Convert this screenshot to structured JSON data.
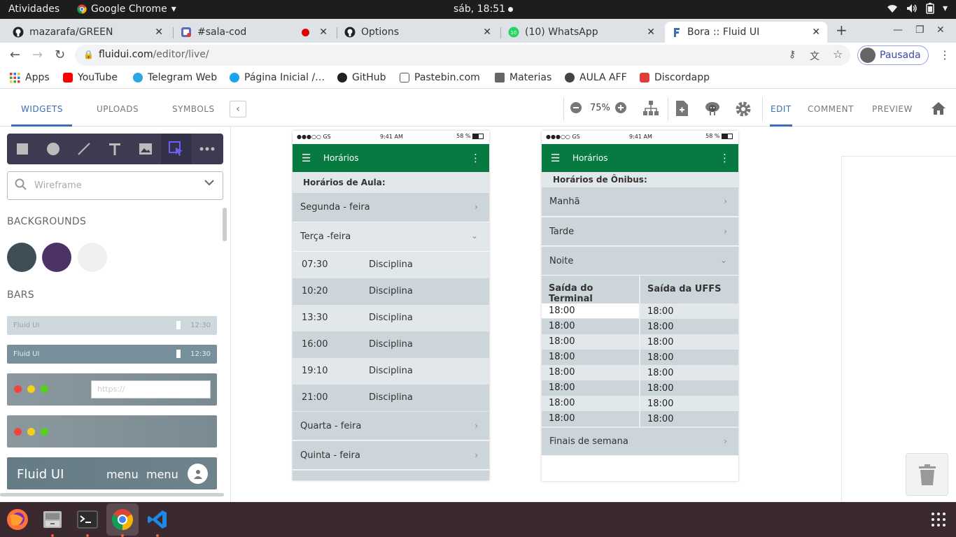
{
  "topbar": {
    "activities": "Atividades",
    "app_name": "Google Chrome",
    "clock": "sáb, 18:51"
  },
  "tabs": [
    {
      "title": "mazarafa/GREEN",
      "icon": "github-icon"
    },
    {
      "title": "#sala-cod",
      "icon": "slack-icon"
    },
    {
      "title": "Options",
      "icon": "github-icon"
    },
    {
      "title": "(10) WhatsApp",
      "icon": "whatsapp-icon"
    },
    {
      "title": "Bora :: Fluid UI",
      "icon": "fluid-icon",
      "active": true
    }
  ],
  "omnibox": {
    "url_host": "fluidui.com",
    "url_path": "/editor/live/",
    "profile_label": "Pausada"
  },
  "bookmarks": [
    {
      "label": "Apps",
      "color": "#e53935"
    },
    {
      "label": "YouTube",
      "color": "#ff0000"
    },
    {
      "label": "Telegram Web",
      "color": "#2ca5e0"
    },
    {
      "label": "Página Inicial /…",
      "color": "#1da1f2"
    },
    {
      "label": "GitHub",
      "color": "#222222"
    },
    {
      "label": "Pastebin.com",
      "color": "#555555"
    },
    {
      "label": "Materias",
      "color": "#666666"
    },
    {
      "label": "AULA AFF",
      "color": "#444444"
    },
    {
      "label": "Discordapp",
      "color": "#e03c3c"
    }
  ],
  "fluid_toolbar": {
    "tabs": [
      "WIDGETS",
      "UPLOADS",
      "SYMBOLS"
    ],
    "zoom": "75%",
    "modes": [
      "EDIT",
      "COMMENT",
      "PREVIEW"
    ],
    "accent": "#3a6fb0"
  },
  "left_panel": {
    "search_placeholder": "Wireframe",
    "backgrounds_heading": "BACKGROUNDS",
    "bars_heading": "BARS",
    "swatches": [
      "#3f4e55",
      "#4b3368",
      "#f0f0f0"
    ],
    "bar1": {
      "label": "Fluid UI",
      "time": "12:30"
    },
    "bar2": {
      "label": "Fluid UI",
      "time": "12:30"
    },
    "bar3_placeholder": "https://",
    "bar5": {
      "title": "Fluid UI",
      "menu1": "menu",
      "menu2": "menu"
    }
  },
  "phone_left": {
    "status": {
      "carrier": "●●●○○ GS",
      "time": "9:41 AM",
      "battery": "58 %"
    },
    "appbar_title": "Horários",
    "subheader": "Horários de Aula:",
    "days": [
      "Segunda - feira",
      "Terça -feira",
      "Quarta - feira",
      "Quinta - feira"
    ],
    "schedule": [
      {
        "time": "07:30",
        "subject": "Disciplina"
      },
      {
        "time": "10:20",
        "subject": "Disciplina"
      },
      {
        "time": "13:30",
        "subject": "Disciplina"
      },
      {
        "time": "16:00",
        "subject": "Disciplina"
      },
      {
        "time": "19:10",
        "subject": "Disciplina"
      },
      {
        "time": "21:00",
        "subject": "Disciplina"
      }
    ]
  },
  "phone_right": {
    "status": {
      "carrier": "●●●○○ GS",
      "time": "9:41 AM",
      "battery": "58 %"
    },
    "appbar_title": "Horários",
    "subheader": "Horários de Ônibus:",
    "periods": [
      "Manhã",
      "Tarde",
      "Noite"
    ],
    "table_headers": [
      "Saída do Terminal",
      "Saída da UFFS"
    ],
    "terminal_times": [
      "18:00",
      "18:00",
      "18:00",
      "18:00",
      "18:00",
      "18:00",
      "18:00",
      "18:00"
    ],
    "uffs_times": [
      "18:00",
      "18:00",
      "18:00",
      "18:00",
      "18:00",
      "18:00",
      "18:00",
      "18:00"
    ],
    "weekend": "Finais de semana"
  },
  "colors": {
    "app_green": "#077a41",
    "row_dark": "#ccd5d9",
    "row_light": "#e2e8ea",
    "toolset_bg": "#3d3b52"
  }
}
